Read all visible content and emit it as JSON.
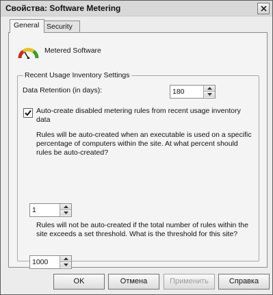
{
  "window": {
    "title": "Свойства: Software Metering"
  },
  "tabs": [
    {
      "label": "General",
      "active": true
    },
    {
      "label": "Security",
      "active": false
    }
  ],
  "header": {
    "app_name": "Metered Software",
    "icon": "meter-gauge-icon"
  },
  "group": {
    "title": "Recent Usage Inventory Settings",
    "retention_label": "Data Retention (in days):",
    "retention_value": "180",
    "checkbox_checked": true,
    "checkbox_label": "Auto-create disabled metering rules from recent usage inventory data",
    "percent_prompt": "Rules will be auto-created when an executable is used on a specific percentage of computers within the site.  At what percent should rules be auto-created?",
    "percent_value": "1",
    "threshold_prompt": "Rules will not be auto-created if the total number of rules within the site exceeds a set threshold.  What is the threshold for this site?",
    "threshold_value": "1000"
  },
  "buttons": {
    "ok": "OK",
    "cancel": "Отмена",
    "apply": "Применить",
    "help": "Справка"
  },
  "colors": {
    "meter_red": "#cc2a1f",
    "meter_yellow": "#e8c01c",
    "meter_green": "#3c9c2a"
  }
}
